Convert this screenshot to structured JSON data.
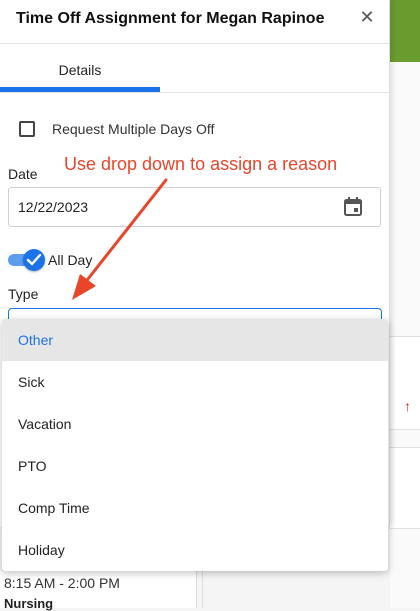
{
  "modal": {
    "title": "Time Off Assignment for Megan Rapinoe",
    "tabs": [
      "Details"
    ],
    "request_multiple_label": "Request Multiple Days Off",
    "date_label": "Date",
    "date_value": "12/22/2023",
    "all_day_label": "All Day",
    "all_day_checked": true,
    "type_label": "Type"
  },
  "annotation": {
    "text": "Use drop down to assign a reason",
    "color": "#e8452a"
  },
  "dropdown": {
    "options": [
      "Other",
      "Sick",
      "Vacation",
      "PTO",
      "Comp Time",
      "Holiday"
    ],
    "selected": "Other"
  },
  "background": {
    "time": "8:15 AM - 2:00 PM",
    "department": "Nursing"
  },
  "colors": {
    "accent": "#1a73e8",
    "header_green": "#6a9b2f"
  }
}
